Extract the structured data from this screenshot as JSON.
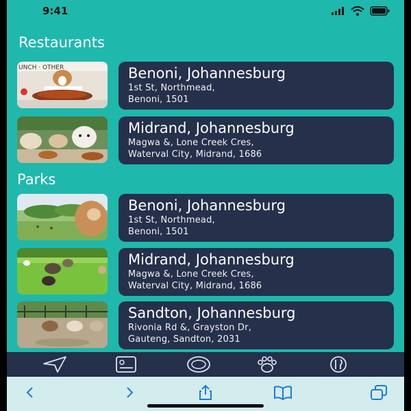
{
  "status": {
    "time": "9:41"
  },
  "sections": [
    {
      "title": "Restaurants",
      "items": [
        {
          "city": "Benoni, Johannesburg",
          "address": "1st St, Northmead,\nBenoni, 1501",
          "image": "dog-at-lunch-table-photo"
        },
        {
          "city": "Midrand, Johannesburg",
          "address": "Magwa &, Lone Creek Cres,\nWaterval City, Midrand, 1686",
          "image": "dogs-with-food-photo"
        }
      ]
    },
    {
      "title": "Parks",
      "items": [
        {
          "city": "Benoni, Johannesburg",
          "address": "1st St, Northmead,\nBenoni, 1501",
          "image": "dog-in-park-photo"
        },
        {
          "city": "Midrand, Johannesburg",
          "address": "Magwa &, Lone Creek Cres,\nWaterval City, Midrand, 1686",
          "image": "dogs-running-on-grass-photo"
        },
        {
          "city": "Sandton, Johannesburg",
          "address": "Rivonia Rd &, Grayston Dr,\nGauteng, Sandton, 2031",
          "image": "dogs-playing-on-dirt-photo"
        }
      ]
    }
  ],
  "tabbar": {
    "icons": [
      "navigation-arrow-icon",
      "card-list-icon",
      "chat-bubble-icon",
      "paw-print-icon",
      "cutlery-icon"
    ]
  },
  "browser": {
    "icons": [
      "back-chevron-icon",
      "forward-chevron-icon",
      "share-icon",
      "bookmarks-book-icon",
      "tabs-icon"
    ]
  },
  "colors": {
    "background": "#1fb8ad",
    "card": "#25304b",
    "browser_bar": "#d3ecee",
    "accent": "#1b7bd8"
  }
}
